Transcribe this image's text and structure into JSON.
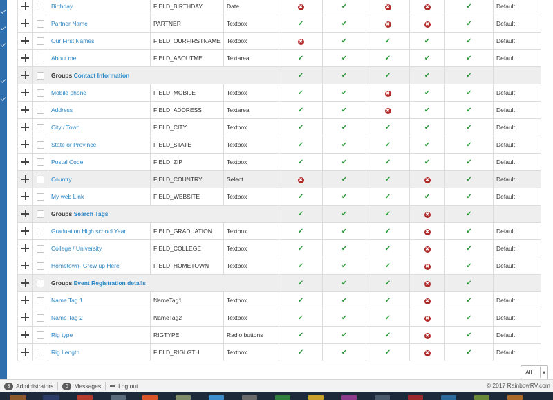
{
  "colors": {
    "sidebar": "#2f6fad",
    "link": "#2a86c4",
    "check_green": "#2e9a3c",
    "cross_red": "#b02a2a",
    "group_row_bg": "#eeeeee"
  },
  "icons": {
    "enabled": "✔",
    "disabled": "✖",
    "move": "move-icon"
  },
  "rows": [
    {
      "type": "field",
      "name": "Birthday",
      "code": "FIELD_BIRTHDAY",
      "fieldtype": "Date",
      "flags": [
        false,
        true,
        false,
        false,
        true
      ],
      "access": "Default"
    },
    {
      "type": "field",
      "name": "Partner Name",
      "code": "PARTNER",
      "fieldtype": "Textbox",
      "flags": [
        true,
        true,
        false,
        false,
        true
      ],
      "access": "Default"
    },
    {
      "type": "field",
      "name": "Our First Names",
      "code": "FIELD_OURFIRSTNAME",
      "fieldtype": "Textbox",
      "flags": [
        false,
        true,
        true,
        true,
        true
      ],
      "access": "Default"
    },
    {
      "type": "field",
      "name": "About me",
      "code": "FIELD_ABOUTME",
      "fieldtype": "Textarea",
      "flags": [
        true,
        true,
        true,
        true,
        true
      ],
      "access": "Default"
    },
    {
      "type": "group",
      "label": "Groups",
      "name": "Contact Information",
      "flags": [
        true,
        true,
        true,
        true,
        true
      ]
    },
    {
      "type": "field",
      "name": "Mobile phone",
      "code": "FIELD_MOBILE",
      "fieldtype": "Textbox",
      "flags": [
        true,
        true,
        false,
        true,
        true
      ],
      "access": "Default"
    },
    {
      "type": "field",
      "name": "Address",
      "code": "FIELD_ADDRESS",
      "fieldtype": "Textarea",
      "flags": [
        true,
        true,
        false,
        true,
        true
      ],
      "access": "Default"
    },
    {
      "type": "field",
      "name": "City / Town",
      "code": "FIELD_CITY",
      "fieldtype": "Textbox",
      "flags": [
        true,
        true,
        true,
        true,
        true
      ],
      "access": "Default"
    },
    {
      "type": "field",
      "name": "State or Province",
      "code": "FIELD_STATE",
      "fieldtype": "Textbox",
      "flags": [
        true,
        true,
        true,
        true,
        true
      ],
      "access": "Default"
    },
    {
      "type": "field",
      "name": "Postal Code",
      "code": "FIELD_ZIP",
      "fieldtype": "Textbox",
      "flags": [
        true,
        true,
        true,
        true,
        true
      ],
      "access": "Default"
    },
    {
      "type": "field",
      "name": "Country",
      "code": "FIELD_COUNTRY",
      "fieldtype": "Select",
      "flags": [
        false,
        true,
        true,
        false,
        true
      ],
      "access": "Default",
      "highlight": true
    },
    {
      "type": "field",
      "name": "My web Link",
      "code": "FIELD_WEBSITE",
      "fieldtype": "Textbox",
      "flags": [
        true,
        true,
        true,
        true,
        true
      ],
      "access": "Default"
    },
    {
      "type": "group",
      "label": "Groups",
      "name": "Search Tags",
      "flags": [
        true,
        true,
        true,
        false,
        true
      ]
    },
    {
      "type": "field",
      "name": "Graduation High school Year",
      "code": "FIELD_GRADUATION",
      "fieldtype": "Textbox",
      "flags": [
        true,
        true,
        true,
        false,
        true
      ],
      "access": "Default"
    },
    {
      "type": "field",
      "name": "College / University",
      "code": "FIELD_COLLEGE",
      "fieldtype": "Textbox",
      "flags": [
        true,
        true,
        true,
        false,
        true
      ],
      "access": "Default"
    },
    {
      "type": "field",
      "name": "Hometown- Grew up Here",
      "code": "FIELD_HOMETOWN",
      "fieldtype": "Textbox",
      "flags": [
        true,
        true,
        true,
        false,
        true
      ],
      "access": "Default"
    },
    {
      "type": "group",
      "label": "Groups",
      "name": "Event Registration details",
      "flags": [
        true,
        true,
        true,
        false,
        true
      ]
    },
    {
      "type": "field",
      "name": "Name Tag 1",
      "code": "NameTag1",
      "fieldtype": "Textbox",
      "flags": [
        true,
        true,
        true,
        false,
        true
      ],
      "access": "Default"
    },
    {
      "type": "field",
      "name": "Name Tag 2",
      "code": "NameTag2",
      "fieldtype": "Textbox",
      "flags": [
        true,
        true,
        true,
        false,
        true
      ],
      "access": "Default"
    },
    {
      "type": "field",
      "name": "Rig type",
      "code": "RIGTYPE",
      "fieldtype": "Radio buttons",
      "flags": [
        true,
        true,
        true,
        false,
        true
      ],
      "access": "Default"
    },
    {
      "type": "field",
      "name": "Rig Length",
      "code": "FIELD_RIGLGTH",
      "fieldtype": "Textbox",
      "flags": [
        true,
        true,
        true,
        false,
        true
      ],
      "access": "Default"
    }
  ],
  "list_limit": {
    "selected": "All"
  },
  "footer": {
    "administrators_count": "3",
    "administrators_label": "Administrators",
    "messages_count": "0",
    "messages_label": "Messages",
    "logout_label": "Log out",
    "copyright": "© 2017 RainbowRV.com"
  }
}
